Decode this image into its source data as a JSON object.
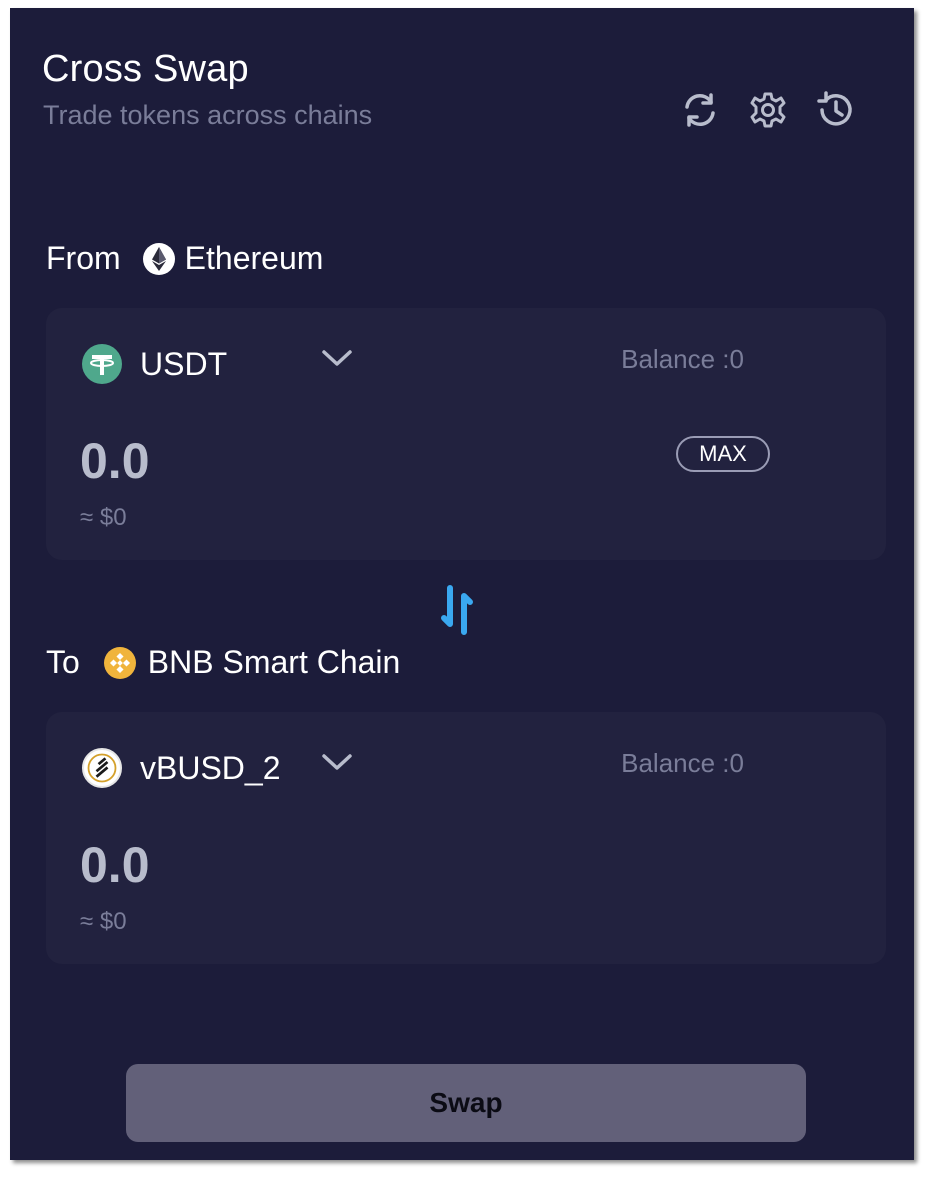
{
  "header": {
    "title": "Cross Swap",
    "subtitle": "Trade tokens across chains",
    "icons": [
      "refresh-icon",
      "settings-icon",
      "history-icon"
    ]
  },
  "from": {
    "label": "From",
    "chain": "Ethereum",
    "chain_icon": "ethereum-icon",
    "token": "USDT",
    "token_icon": "usdt-icon",
    "balance": "Balance :0",
    "amount": "0.0",
    "usd": "≈ $0",
    "max_label": "MAX"
  },
  "to": {
    "label": "To",
    "chain": "BNB Smart Chain",
    "chain_icon": "bnb-icon",
    "token": "vBUSD_2",
    "token_icon": "vbusd-icon",
    "balance": "Balance :0",
    "amount": "0.0",
    "usd": "≈ $0"
  },
  "swap_label": "Swap",
  "colors": {
    "background": "#1c1c3a",
    "card": "#22223f",
    "accent_arrow": "#3aa8f0",
    "swap_button": "#626079",
    "usdt": "#4fa88c",
    "bnb": "#f0b43c"
  }
}
